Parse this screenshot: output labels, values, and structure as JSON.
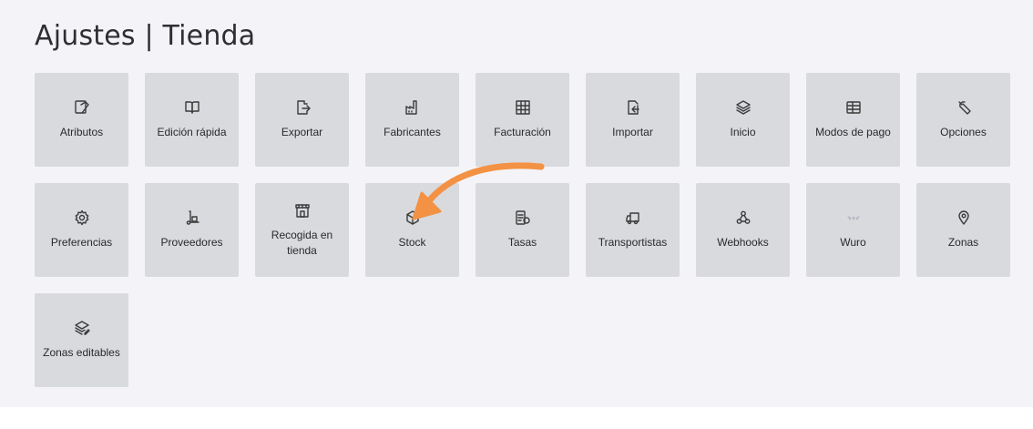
{
  "page": {
    "title": "Ajustes | Tienda"
  },
  "tiles": [
    {
      "label": "Atributos",
      "icon": "attributes-icon"
    },
    {
      "label": "Edición rápida",
      "icon": "open-book-icon"
    },
    {
      "label": "Exportar",
      "icon": "export-file-icon"
    },
    {
      "label": "Fabricantes",
      "icon": "factory-icon"
    },
    {
      "label": "Facturación",
      "icon": "grid-table-icon"
    },
    {
      "label": "Importar",
      "icon": "import-file-icon"
    },
    {
      "label": "Inicio",
      "icon": "layers-icon"
    },
    {
      "label": "Modos de pago",
      "icon": "payment-table-icon"
    },
    {
      "label": "Opciones",
      "icon": "wrench-icon"
    },
    {
      "label": "Preferencias",
      "icon": "gear-icon"
    },
    {
      "label": "Proveedores",
      "icon": "hand-truck-icon"
    },
    {
      "label": "Recogida en tienda",
      "icon": "storefront-icon"
    },
    {
      "label": "Stock",
      "icon": "box-icon"
    },
    {
      "label": "Tasas",
      "icon": "tax-list-icon"
    },
    {
      "label": "Transportistas",
      "icon": "truck-icon"
    },
    {
      "label": "Webhooks",
      "icon": "webhook-icon"
    },
    {
      "label": "Wuro",
      "icon": "wuro-logo-icon"
    },
    {
      "label": "Zonas",
      "icon": "map-pin-icon"
    },
    {
      "label": "Zonas editables",
      "icon": "editable-layers-icon"
    }
  ],
  "colors": {
    "background": "#f4f4f8",
    "tile": "#d8dade",
    "arrow": "#f39244"
  }
}
